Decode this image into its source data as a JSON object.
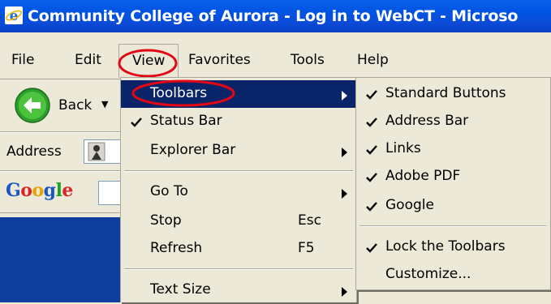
{
  "window": {
    "title": "Community College of Aurora - Log in to WebCT - Microso",
    "app_icon": "ie-icon"
  },
  "menubar": {
    "items": [
      "File",
      "Edit",
      "View",
      "Favorites",
      "Tools",
      "Help"
    ]
  },
  "toolbar": {
    "back_label": "Back",
    "address_label": "Address",
    "google_logo": "Google"
  },
  "view_menu": {
    "items": [
      {
        "label": "Toolbars",
        "checked": false,
        "submenu": true,
        "shortcut": "",
        "highlighted": true
      },
      {
        "label": "Status Bar",
        "checked": true,
        "submenu": false,
        "shortcut": ""
      },
      {
        "label": "Explorer Bar",
        "checked": false,
        "submenu": true,
        "shortcut": ""
      },
      {
        "label": "Go To",
        "checked": false,
        "submenu": true,
        "shortcut": ""
      },
      {
        "label": "Stop",
        "checked": false,
        "submenu": false,
        "shortcut": "Esc"
      },
      {
        "label": "Refresh",
        "checked": false,
        "submenu": false,
        "shortcut": "F5"
      },
      {
        "label": "Text Size",
        "checked": false,
        "submenu": true,
        "shortcut": ""
      }
    ]
  },
  "toolbars_submenu": {
    "items": [
      {
        "label": "Standard Buttons",
        "checked": true
      },
      {
        "label": "Address Bar",
        "checked": true
      },
      {
        "label": "Links",
        "checked": true
      },
      {
        "label": "Adobe PDF",
        "checked": true
      },
      {
        "label": "Google",
        "checked": true
      },
      {
        "label": "Lock the Toolbars",
        "checked": true
      },
      {
        "label": "Customize...",
        "checked": false
      }
    ]
  },
  "colors": {
    "highlight": "#0A246A",
    "annotation": "#E30613",
    "titlebar": "#0054E3",
    "page_body": "#103E9C"
  }
}
